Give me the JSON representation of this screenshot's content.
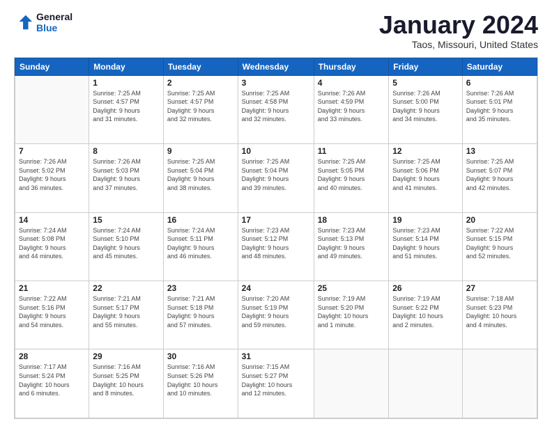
{
  "logo": {
    "line1": "General",
    "line2": "Blue"
  },
  "title": "January 2024",
  "subtitle": "Taos, Missouri, United States",
  "weekdays": [
    "Sunday",
    "Monday",
    "Tuesday",
    "Wednesday",
    "Thursday",
    "Friday",
    "Saturday"
  ],
  "weeks": [
    [
      {
        "day": "",
        "info": ""
      },
      {
        "day": "1",
        "info": "Sunrise: 7:25 AM\nSunset: 4:57 PM\nDaylight: 9 hours\nand 31 minutes."
      },
      {
        "day": "2",
        "info": "Sunrise: 7:25 AM\nSunset: 4:57 PM\nDaylight: 9 hours\nand 32 minutes."
      },
      {
        "day": "3",
        "info": "Sunrise: 7:25 AM\nSunset: 4:58 PM\nDaylight: 9 hours\nand 32 minutes."
      },
      {
        "day": "4",
        "info": "Sunrise: 7:26 AM\nSunset: 4:59 PM\nDaylight: 9 hours\nand 33 minutes."
      },
      {
        "day": "5",
        "info": "Sunrise: 7:26 AM\nSunset: 5:00 PM\nDaylight: 9 hours\nand 34 minutes."
      },
      {
        "day": "6",
        "info": "Sunrise: 7:26 AM\nSunset: 5:01 PM\nDaylight: 9 hours\nand 35 minutes."
      }
    ],
    [
      {
        "day": "7",
        "info": "Sunrise: 7:26 AM\nSunset: 5:02 PM\nDaylight: 9 hours\nand 36 minutes."
      },
      {
        "day": "8",
        "info": "Sunrise: 7:26 AM\nSunset: 5:03 PM\nDaylight: 9 hours\nand 37 minutes."
      },
      {
        "day": "9",
        "info": "Sunrise: 7:25 AM\nSunset: 5:04 PM\nDaylight: 9 hours\nand 38 minutes."
      },
      {
        "day": "10",
        "info": "Sunrise: 7:25 AM\nSunset: 5:04 PM\nDaylight: 9 hours\nand 39 minutes."
      },
      {
        "day": "11",
        "info": "Sunrise: 7:25 AM\nSunset: 5:05 PM\nDaylight: 9 hours\nand 40 minutes."
      },
      {
        "day": "12",
        "info": "Sunrise: 7:25 AM\nSunset: 5:06 PM\nDaylight: 9 hours\nand 41 minutes."
      },
      {
        "day": "13",
        "info": "Sunrise: 7:25 AM\nSunset: 5:07 PM\nDaylight: 9 hours\nand 42 minutes."
      }
    ],
    [
      {
        "day": "14",
        "info": "Sunrise: 7:24 AM\nSunset: 5:08 PM\nDaylight: 9 hours\nand 44 minutes."
      },
      {
        "day": "15",
        "info": "Sunrise: 7:24 AM\nSunset: 5:10 PM\nDaylight: 9 hours\nand 45 minutes."
      },
      {
        "day": "16",
        "info": "Sunrise: 7:24 AM\nSunset: 5:11 PM\nDaylight: 9 hours\nand 46 minutes."
      },
      {
        "day": "17",
        "info": "Sunrise: 7:23 AM\nSunset: 5:12 PM\nDaylight: 9 hours\nand 48 minutes."
      },
      {
        "day": "18",
        "info": "Sunrise: 7:23 AM\nSunset: 5:13 PM\nDaylight: 9 hours\nand 49 minutes."
      },
      {
        "day": "19",
        "info": "Sunrise: 7:23 AM\nSunset: 5:14 PM\nDaylight: 9 hours\nand 51 minutes."
      },
      {
        "day": "20",
        "info": "Sunrise: 7:22 AM\nSunset: 5:15 PM\nDaylight: 9 hours\nand 52 minutes."
      }
    ],
    [
      {
        "day": "21",
        "info": "Sunrise: 7:22 AM\nSunset: 5:16 PM\nDaylight: 9 hours\nand 54 minutes."
      },
      {
        "day": "22",
        "info": "Sunrise: 7:21 AM\nSunset: 5:17 PM\nDaylight: 9 hours\nand 55 minutes."
      },
      {
        "day": "23",
        "info": "Sunrise: 7:21 AM\nSunset: 5:18 PM\nDaylight: 9 hours\nand 57 minutes."
      },
      {
        "day": "24",
        "info": "Sunrise: 7:20 AM\nSunset: 5:19 PM\nDaylight: 9 hours\nand 59 minutes."
      },
      {
        "day": "25",
        "info": "Sunrise: 7:19 AM\nSunset: 5:20 PM\nDaylight: 10 hours\nand 1 minute."
      },
      {
        "day": "26",
        "info": "Sunrise: 7:19 AM\nSunset: 5:22 PM\nDaylight: 10 hours\nand 2 minutes."
      },
      {
        "day": "27",
        "info": "Sunrise: 7:18 AM\nSunset: 5:23 PM\nDaylight: 10 hours\nand 4 minutes."
      }
    ],
    [
      {
        "day": "28",
        "info": "Sunrise: 7:17 AM\nSunset: 5:24 PM\nDaylight: 10 hours\nand 6 minutes."
      },
      {
        "day": "29",
        "info": "Sunrise: 7:16 AM\nSunset: 5:25 PM\nDaylight: 10 hours\nand 8 minutes."
      },
      {
        "day": "30",
        "info": "Sunrise: 7:16 AM\nSunset: 5:26 PM\nDaylight: 10 hours\nand 10 minutes."
      },
      {
        "day": "31",
        "info": "Sunrise: 7:15 AM\nSunset: 5:27 PM\nDaylight: 10 hours\nand 12 minutes."
      },
      {
        "day": "",
        "info": ""
      },
      {
        "day": "",
        "info": ""
      },
      {
        "day": "",
        "info": ""
      }
    ]
  ]
}
